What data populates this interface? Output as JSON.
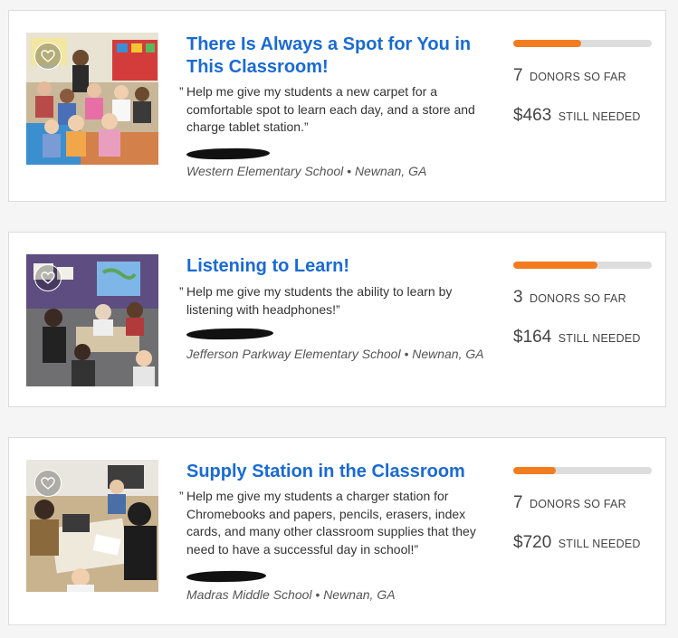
{
  "colors": {
    "title": "#1a6ad1",
    "progress_fill": "#f47c20",
    "progress_track": "#dddddd",
    "card_border": "#dcdcdc"
  },
  "projects": [
    {
      "title": "There Is Always a Spot for You in This Classroom!",
      "quote_mark": "”",
      "quote": "Help me give my students a new carpet for a comfortable spot to learn each day, and a store and charge tablet station.”",
      "school": "Western Elementary School • Newnan, GA",
      "progress_fraction": 0.49,
      "donors_count": "7",
      "donors_label": "DONORS SO FAR",
      "still_needed_amount": "$463",
      "still_needed_label": "STILL NEEDED",
      "favorite_icon": "heart-outline-icon"
    },
    {
      "title": "Listening to Learn!",
      "quote_mark": "”",
      "quote": "Help me give my students the ability to learn by listening with headphones!”",
      "school": "Jefferson Parkway Elementary School • Newnan, GA",
      "progress_fraction": 0.61,
      "donors_count": "3",
      "donors_label": "DONORS SO FAR",
      "still_needed_amount": "$164",
      "still_needed_label": "STILL NEEDED",
      "favorite_icon": "heart-outline-icon"
    },
    {
      "title": "Supply Station in the Classroom",
      "quote_mark": "”",
      "quote": "Help me give my students a charger station for Chromebooks and papers, pencils, erasers, index cards, and many other classroom supplies that they need to have a successful day in school!”",
      "school": "Madras Middle School • Newnan, GA",
      "progress_fraction": 0.31,
      "donors_count": "7",
      "donors_label": "DONORS SO FAR",
      "still_needed_amount": "$720",
      "still_needed_label": "STILL NEEDED",
      "favorite_icon": "heart-outline-icon"
    }
  ]
}
